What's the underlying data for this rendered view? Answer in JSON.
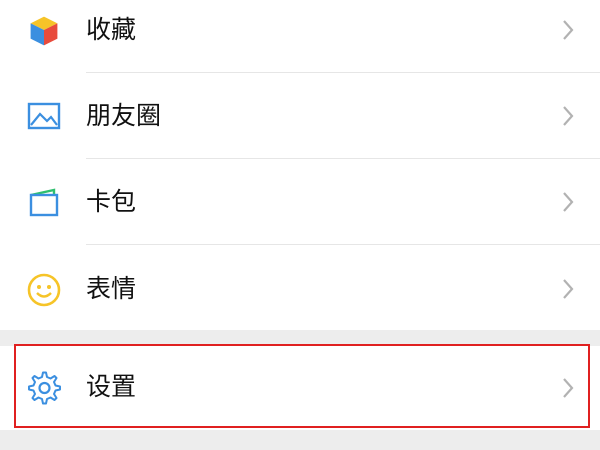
{
  "menu": {
    "items": [
      {
        "label": "收藏",
        "icon": "favorites-cube-icon"
      },
      {
        "label": "朋友圈",
        "icon": "moments-image-icon"
      },
      {
        "label": "卡包",
        "icon": "card-wallet-icon"
      },
      {
        "label": "表情",
        "icon": "sticker-smiley-icon"
      }
    ],
    "settings": {
      "label": "设置",
      "icon": "gear-icon"
    }
  },
  "colors": {
    "background": "#ededed",
    "row_background": "#ffffff",
    "highlight_border": "#e02020",
    "icon_blue": "#3b8fe0",
    "smiley_yellow": "#f6c428",
    "card_green": "#2fbf6f"
  }
}
